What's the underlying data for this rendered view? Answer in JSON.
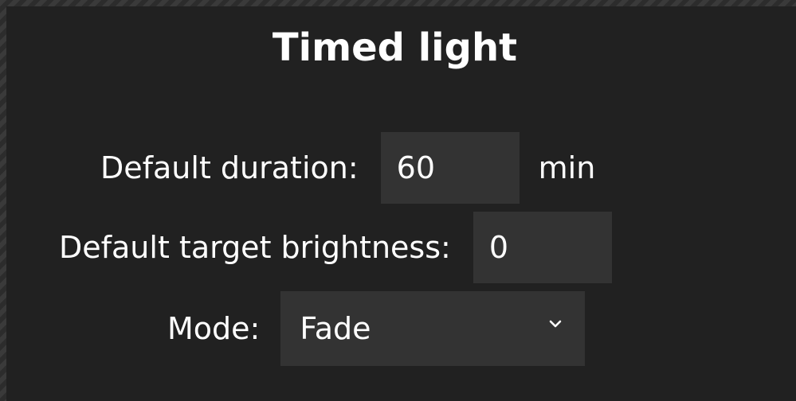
{
  "dialog": {
    "title": "Timed light"
  },
  "fields": {
    "duration": {
      "label": "Default duration:",
      "value": "60",
      "unit": "min"
    },
    "brightness": {
      "label": "Default target brightness:",
      "value": "0"
    },
    "mode": {
      "label": "Mode:",
      "selected": "Fade"
    }
  },
  "icons": {
    "dropdown": "chevron-down-icon"
  },
  "colors": {
    "panel_bg": "#212121",
    "field_bg": "#333333",
    "text": "#ffffff"
  }
}
